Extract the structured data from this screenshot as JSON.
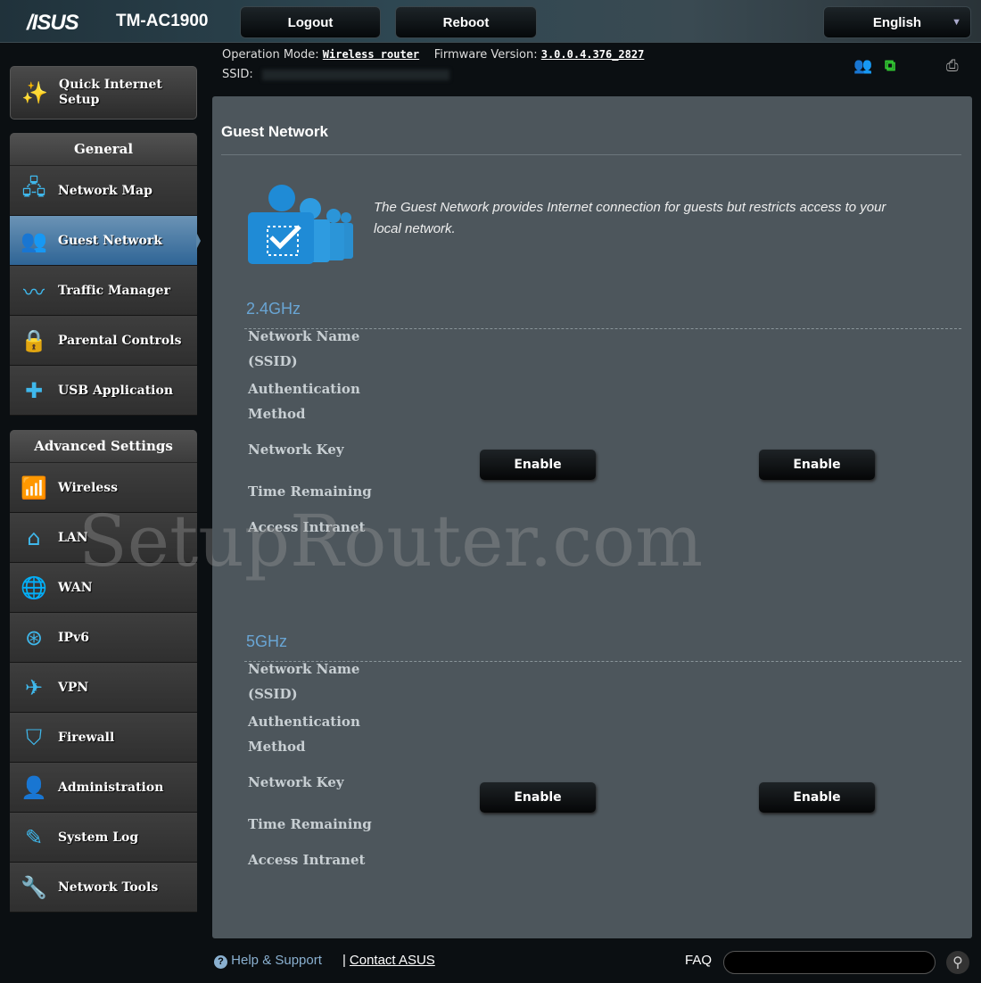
{
  "header": {
    "brand": "/ISUS",
    "model": "TM-AC1900",
    "logout": "Logout",
    "reboot": "Reboot",
    "language": "English"
  },
  "status": {
    "op_mode_label": "Operation Mode:",
    "op_mode": "Wireless router",
    "fw_label": "Firmware Version:",
    "fw": "3.0.0.4.376_2827",
    "ssid_label": "SSID:"
  },
  "sidebar": {
    "qis": "Quick Internet Setup",
    "general": "General",
    "general_items": [
      {
        "label": "Network Map",
        "icon": "network-map-icon"
      },
      {
        "label": "Guest Network",
        "icon": "guest-network-icon",
        "active": true
      },
      {
        "label": "Traffic Manager",
        "icon": "traffic-manager-icon"
      },
      {
        "label": "Parental Controls",
        "icon": "lock-icon"
      },
      {
        "label": "USB Application",
        "icon": "puzzle-icon"
      }
    ],
    "advanced": "Advanced Settings",
    "advanced_items": [
      {
        "label": "Wireless",
        "icon": "wifi-icon"
      },
      {
        "label": "LAN",
        "icon": "home-icon"
      },
      {
        "label": "WAN",
        "icon": "globe-icon"
      },
      {
        "label": "IPv6",
        "icon": "ipv6-icon"
      },
      {
        "label": "VPN",
        "icon": "vpn-icon"
      },
      {
        "label": "Firewall",
        "icon": "shield-icon"
      },
      {
        "label": "Administration",
        "icon": "user-icon"
      },
      {
        "label": "System Log",
        "icon": "log-icon"
      },
      {
        "label": "Network Tools",
        "icon": "tools-icon"
      }
    ]
  },
  "main": {
    "title": "Guest Network",
    "description": "The Guest Network provides Internet connection for guests but restricts access to your local network.",
    "bands": [
      {
        "name": "2.4GHz"
      },
      {
        "name": "5GHz"
      }
    ],
    "fields": [
      "Network Name (SSID)",
      "Authentication Method",
      "Network Key",
      "Time Remaining",
      "Access Intranet"
    ],
    "enable": "Enable"
  },
  "watermark": "SetupRouter.com",
  "footer": {
    "help": "Help & Support",
    "contact": "Contact ASUS",
    "faq": "FAQ",
    "faq_placeholder": ""
  },
  "colors": {
    "accent": "#3fb8ec",
    "band": "#69a5d4",
    "panel": "#4d565c"
  }
}
